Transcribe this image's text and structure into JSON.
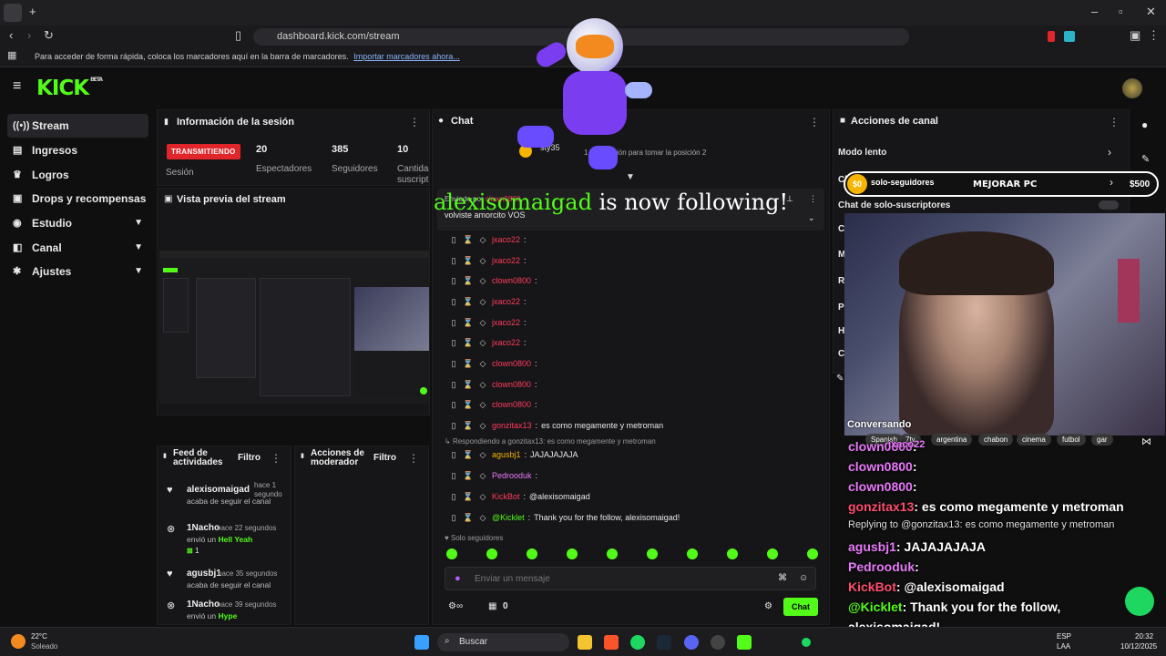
{
  "browser": {
    "url": "dashboard.kick.com/stream",
    "bookmarks_text": "Para acceder de forma rápida, coloca los marcadores aquí en la barra de marcadores.",
    "bookmarks_link": "Importar marcadores ahora..."
  },
  "logo": "KICK",
  "logo_tag": "BETA",
  "nav": [
    {
      "label": "Stream",
      "icon": "stream-icon"
    },
    {
      "label": "Ingresos",
      "icon": "money-icon"
    },
    {
      "label": "Logros",
      "icon": "trophy-icon"
    },
    {
      "label": "Drops y recompensas",
      "icon": "gift-icon"
    },
    {
      "label": "Estudio",
      "icon": "studio-icon"
    },
    {
      "label": "Canal",
      "icon": "channel-icon"
    },
    {
      "label": "Ajustes",
      "icon": "gear-icon"
    }
  ],
  "session": {
    "title": "Información de la sesión",
    "live_badge": "TRANSMITIENDO",
    "session_label": "Sesión",
    "viewers": "20",
    "viewers_label": "Espectadores",
    "followers": "385",
    "followers_label": "Seguidores",
    "subs": "10",
    "subs_label": "Cantida suscript"
  },
  "preview": {
    "title": "Vista previa del stream"
  },
  "feed": {
    "title": "Feed de actividades",
    "filter": "Filtro",
    "items": [
      {
        "name": "alexisomaigad",
        "time": "hace 1 segundo",
        "action": "acaba de seguir el canal",
        "highlight": "",
        "count": ""
      },
      {
        "name": "1Nacho",
        "time": "hace 22 segundos",
        "action": "envió un",
        "highlight": "Hell Yeah",
        "count": "1"
      },
      {
        "name": "agusbj1",
        "time": "hace 35 segundos",
        "action": "acaba de seguir el canal",
        "highlight": "",
        "count": ""
      },
      {
        "name": "1Nacho",
        "time": "hace 39 segundos",
        "action": "envió un",
        "highlight": "Hype",
        "count": ""
      }
    ]
  },
  "mod": {
    "title": "Acciones de moderador",
    "filter": "Filtro"
  },
  "chat": {
    "title": "Chat",
    "leader_name": "sty35",
    "leader_text": "1 suscripción para tomar la posición 2",
    "pinned_by": "Enviado por",
    "pinned_user": "clown0800",
    "pinned_msg": "volviste amorcito VOS",
    "messages": [
      {
        "user": "jxaco22",
        "text": ""
      },
      {
        "user": "jxaco22",
        "text": ""
      },
      {
        "user": "clown0800",
        "text": ""
      },
      {
        "user": "jxaco22",
        "text": ""
      },
      {
        "user": "jxaco22",
        "text": ""
      },
      {
        "user": "jxaco22",
        "text": ""
      },
      {
        "user": "clown0800",
        "text": ""
      },
      {
        "user": "clown0800",
        "text": ""
      },
      {
        "user": "clown0800",
        "text": ""
      },
      {
        "user": "gonzitax13",
        "text": "es como megamente y metroman"
      }
    ],
    "reply_to": "Respondiendo a gonzitax13: es como megamente y metroman",
    "messages2": [
      {
        "user": "agusbj1",
        "text": "JAJAJAJAJA"
      },
      {
        "user": "Pedrooduk",
        "text": ""
      },
      {
        "user": "KickBot",
        "text": "@alexisomaigad"
      },
      {
        "user": "@Kicklet",
        "text": "Thank you for the follow, alexisomaigad!"
      }
    ],
    "followers_only": "Solo seguidores",
    "placeholder": "Enviar un mensaje",
    "points": "0",
    "send": "Chat"
  },
  "follow_banner": {
    "name": "alexisomaigad",
    "text": "is now following!"
  },
  "channel_actions": {
    "title": "Acciones de canal",
    "items": [
      "Modo lento",
      "Ch",
      "Chat de solo-suscriptores",
      "Cl",
      "M",
      "Re",
      "Pa",
      "He",
      "Co"
    ],
    "followers_only_partial": "solo-seguidores"
  },
  "goal": {
    "start": "$0",
    "label": "MEJORAR PC",
    "end": "$500",
    "progress": 0
  },
  "tags": [
    "Spanish",
    "7tv",
    "argentina",
    "chabon",
    "cinema",
    "futbol",
    "gar"
  ],
  "overlay_chat": [
    {
      "user": "jxaco22",
      "text": ""
    },
    {
      "user": "clown0800",
      "text": ""
    },
    {
      "user": "clown0800",
      "text": ""
    },
    {
      "user": "clown0800",
      "text": ""
    },
    {
      "user": "gonzitax13",
      "text": "es como megamente y metroman"
    },
    {
      "user": "",
      "text": "Replying to @gonzitax13: es como megamente y metroman"
    },
    {
      "user": "agusbj1",
      "text": "JAJAJAJAJA"
    },
    {
      "user": "Pedrooduk",
      "text": ""
    },
    {
      "user": "KickBot",
      "text": "@alexisomaigad"
    },
    {
      "user": "@Kicklet",
      "text": "Thank you for the follow,"
    },
    {
      "user": "",
      "text": "alexisomaigad!"
    }
  ],
  "overlay_partial": "Conversando",
  "taskbar": {
    "weather_temp": "22°C",
    "weather_text": "Soleado",
    "search": "Buscar",
    "lang1": "ESP",
    "lang2": "LAA",
    "time": "20:32",
    "date": "10/12/2025"
  },
  "colors": {
    "kick_green": "#53fc18",
    "live_red": "#e0262b",
    "username_red": "#ff3b5c",
    "gold": "#f4b400"
  }
}
